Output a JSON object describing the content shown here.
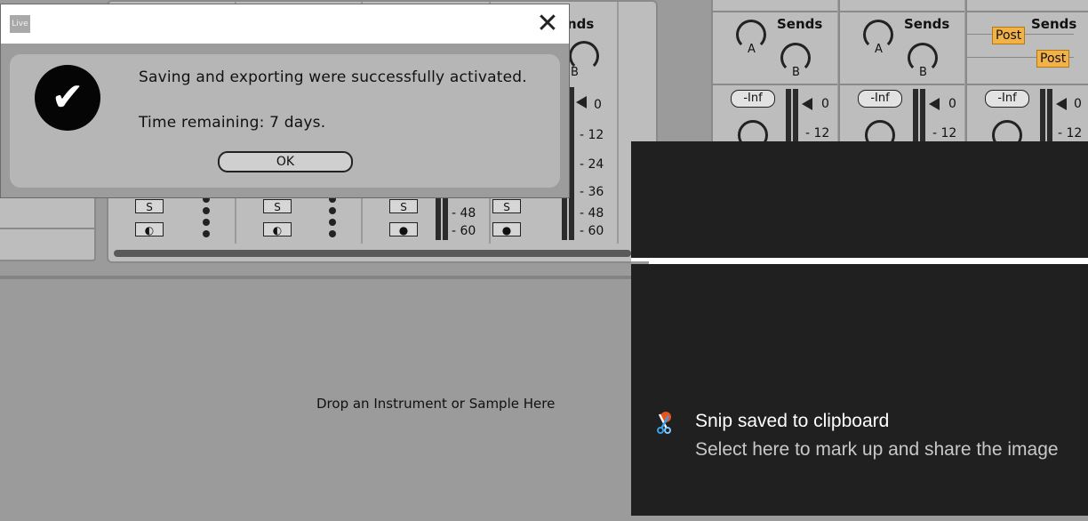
{
  "dialog": {
    "app_icon_label": "Live",
    "close_glyph": "✕",
    "message_line1": "Saving and exporting were successfully activated.",
    "message_line2": "Time remaining: 7 days.",
    "ok_label": "OK",
    "check_icon": "checkmark-icon"
  },
  "background": {
    "sends_partial": "nds",
    "partial_knob_label": "B",
    "drop_hint": "Drop an Instrument or Sample Here",
    "solo_label": "S",
    "meter_scale": [
      "0",
      "12",
      "24",
      "36",
      "48",
      "60"
    ],
    "track_meter_labels": [
      "48",
      "60"
    ]
  },
  "right_mixer": {
    "sends_title": "Sends",
    "knob_a": "A",
    "knob_b": "B",
    "post_label": "Post",
    "volume_label": "-Inf",
    "scale_0": "0",
    "scale_12": "12"
  },
  "snip": {
    "title": "Snip saved to clipboard",
    "subtitle": "Select here to mark up and share the image",
    "icon": "snipping-tool-icon"
  }
}
